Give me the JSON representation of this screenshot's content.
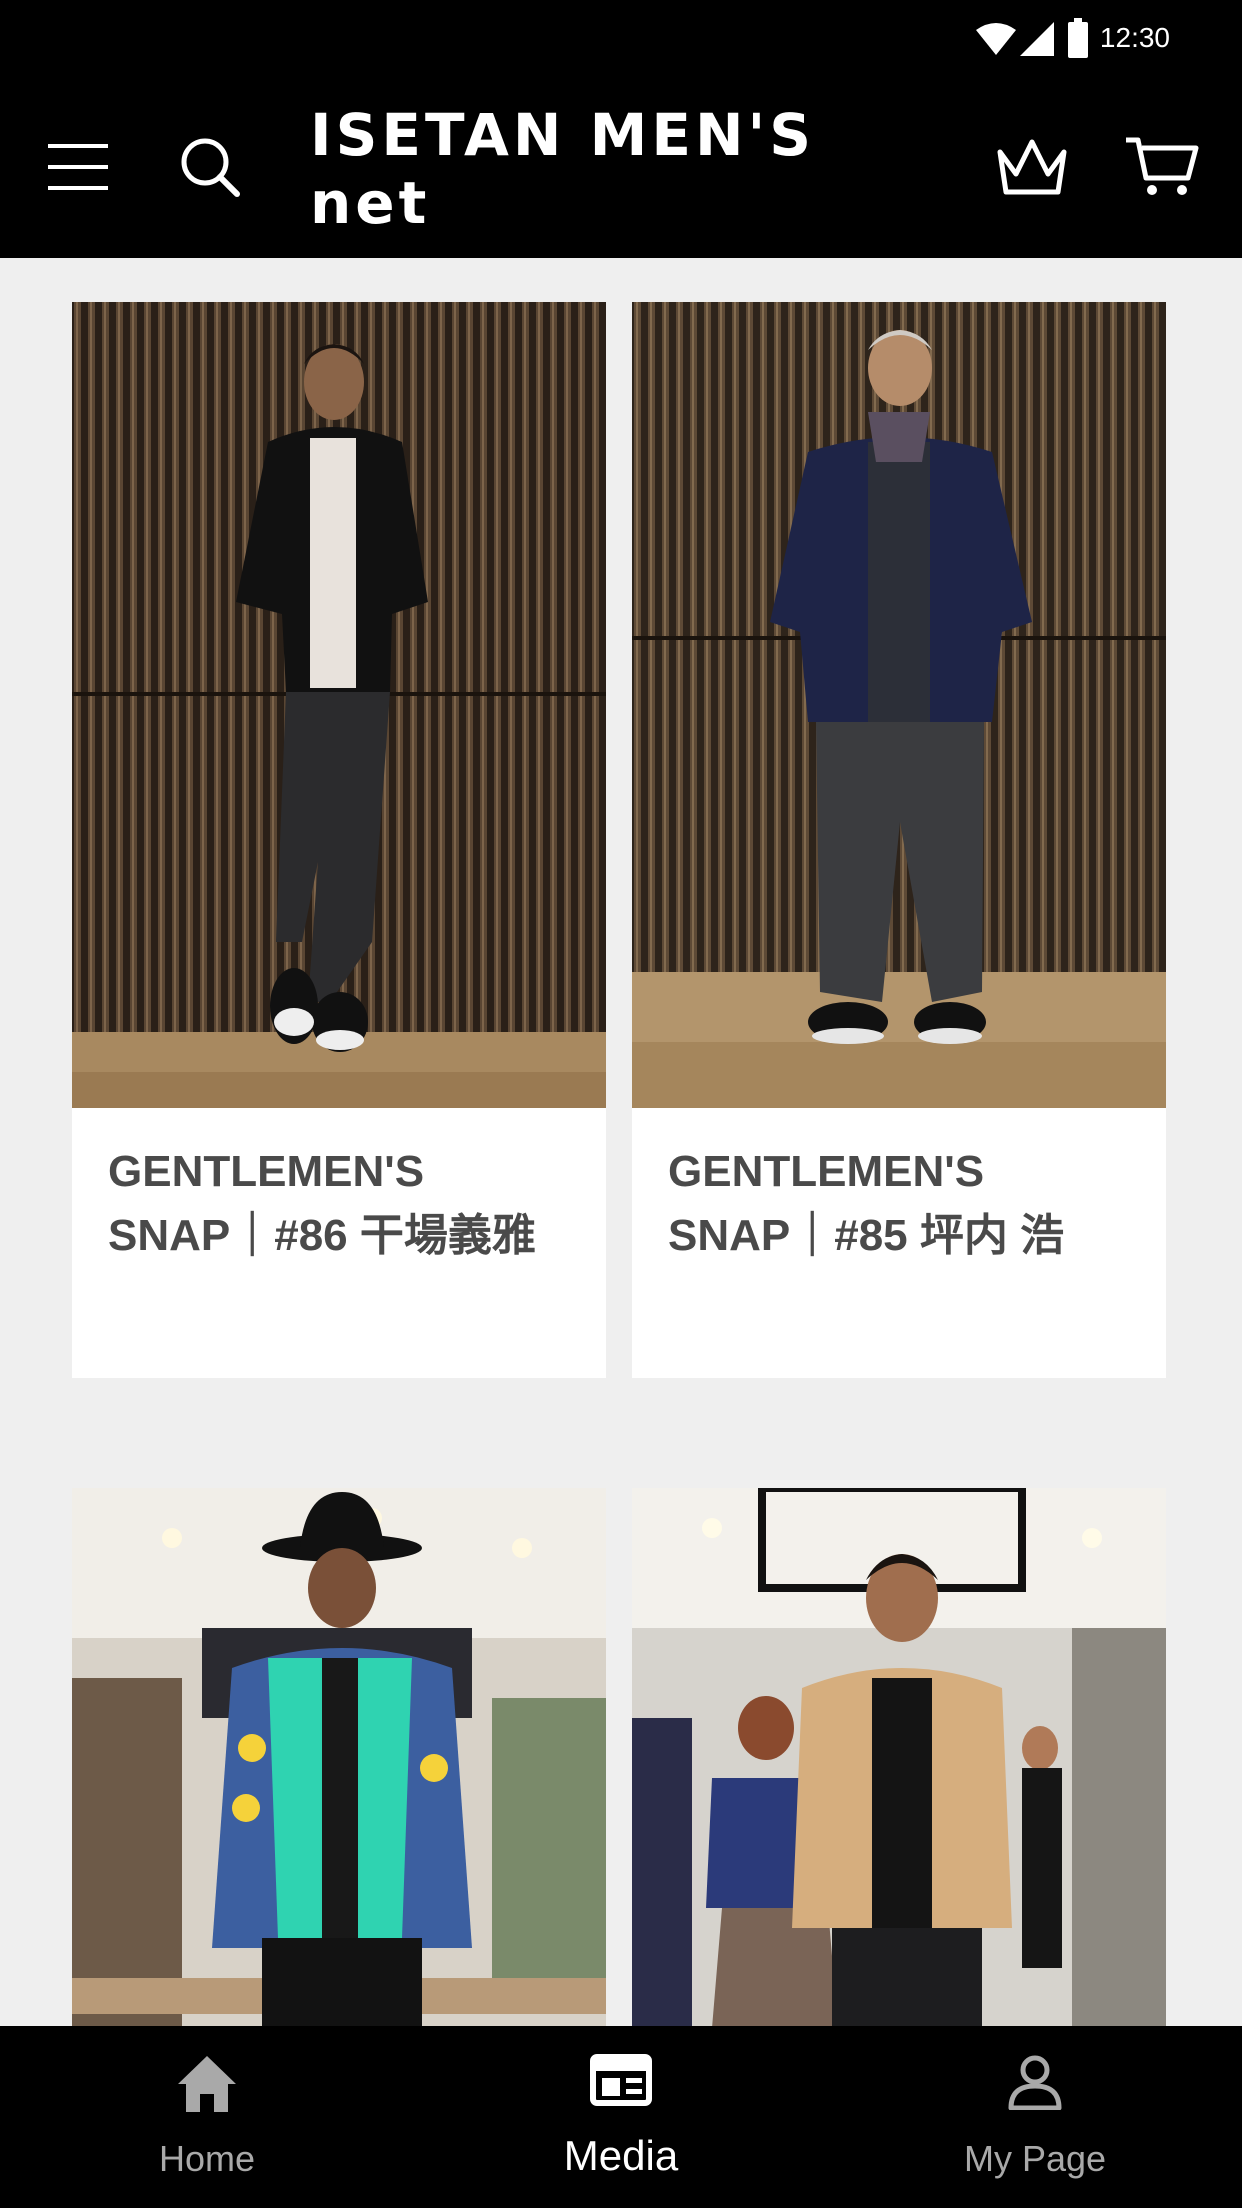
{
  "status_bar": {
    "time": "12:30",
    "icons": [
      "wifi-icon",
      "signal-icon",
      "battery-icon"
    ]
  },
  "header": {
    "logo": "ISETAN MEN'S net",
    "left_icons": [
      "menu-icon",
      "search-icon"
    ],
    "right_icons": [
      "crown-icon",
      "cart-icon"
    ]
  },
  "cards": [
    {
      "title_line1": "GENTLEMEN'S",
      "title_line2": "SNAP｜#86 干場義雅"
    },
    {
      "title_line1": "GENTLEMEN'S",
      "title_line2": "SNAP｜#85 坪内 浩"
    },
    {
      "title_line1": "",
      "title_line2": ""
    },
    {
      "title_line1": "",
      "title_line2": ""
    }
  ],
  "bottom_nav": {
    "items": [
      {
        "label": "Home",
        "icon": "home-icon",
        "active": false
      },
      {
        "label": "Media",
        "icon": "media-icon",
        "active": true
      },
      {
        "label": "My Page",
        "icon": "user-icon",
        "active": false
      }
    ]
  },
  "colors": {
    "header_bg": "#000000",
    "page_bg": "#efefef",
    "title_text": "#4a4a4a",
    "nav_inactive": "#a9a9a9",
    "nav_active": "#ffffff"
  }
}
